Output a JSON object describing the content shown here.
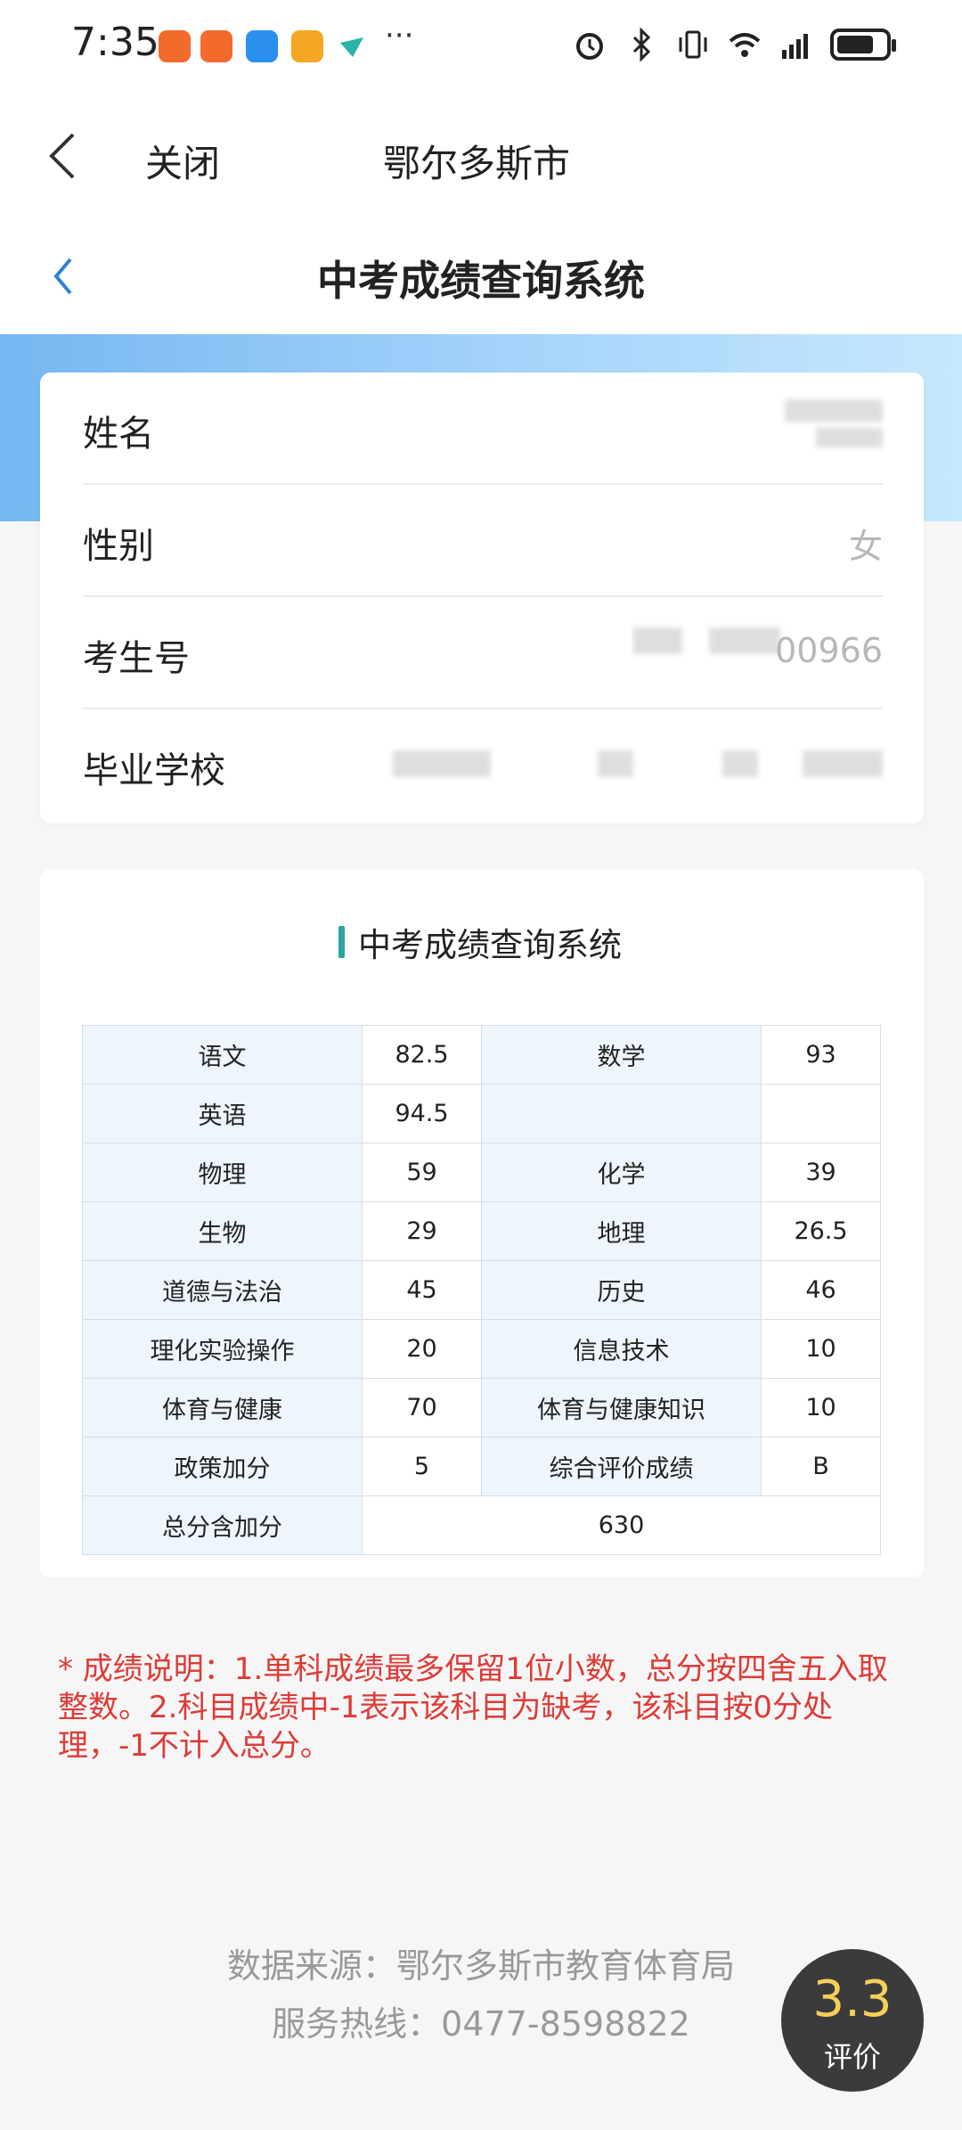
{
  "status_bar": {
    "time": "7:35",
    "more": "···"
  },
  "nav": {
    "close_label": "关闭",
    "title": "鄂尔多斯市"
  },
  "header": {
    "title": "中考成绩查询系统"
  },
  "info": {
    "name_label": "姓名",
    "gender_label": "性别",
    "gender_value": "女",
    "exam_id_label": "考生号",
    "exam_id_value": "00966",
    "school_label": "毕业学校"
  },
  "scores": {
    "title": "中考成绩查询系统",
    "rows": [
      [
        "语文",
        "82.5",
        "数学",
        "93"
      ],
      [
        "英语",
        "94.5",
        "",
        ""
      ],
      [
        "物理",
        "59",
        "化学",
        "39"
      ],
      [
        "生物",
        "29",
        "地理",
        "26.5"
      ],
      [
        "道德与法治",
        "45",
        "历史",
        "46"
      ],
      [
        "理化实验操作",
        "20",
        "信息技术",
        "10"
      ],
      [
        "体育与健康",
        "70",
        "体育与健康知识",
        "10"
      ],
      [
        "政策加分",
        "5",
        "综合评价成绩",
        "B"
      ]
    ],
    "total_label": "总分含加分",
    "total_value": "630"
  },
  "note": "* 成绩说明：1.单科成绩最多保留1位小数，总分按四舍五入取整数。2.科目成绩中-1表示该科目为缺考，该科目按0分处理，-1不计入总分。",
  "footer": {
    "source": "数据来源：鄂尔多斯市教育体育局",
    "hotline": "服务热线：0477-8598822"
  },
  "rating": {
    "score": "3.3",
    "label": "评价"
  },
  "colors": {
    "note_red": "#de3b36",
    "accent_teal": "#2aa69c",
    "banner_blue": "#8cc8f7",
    "table_header_bg": "#eef5fd"
  }
}
